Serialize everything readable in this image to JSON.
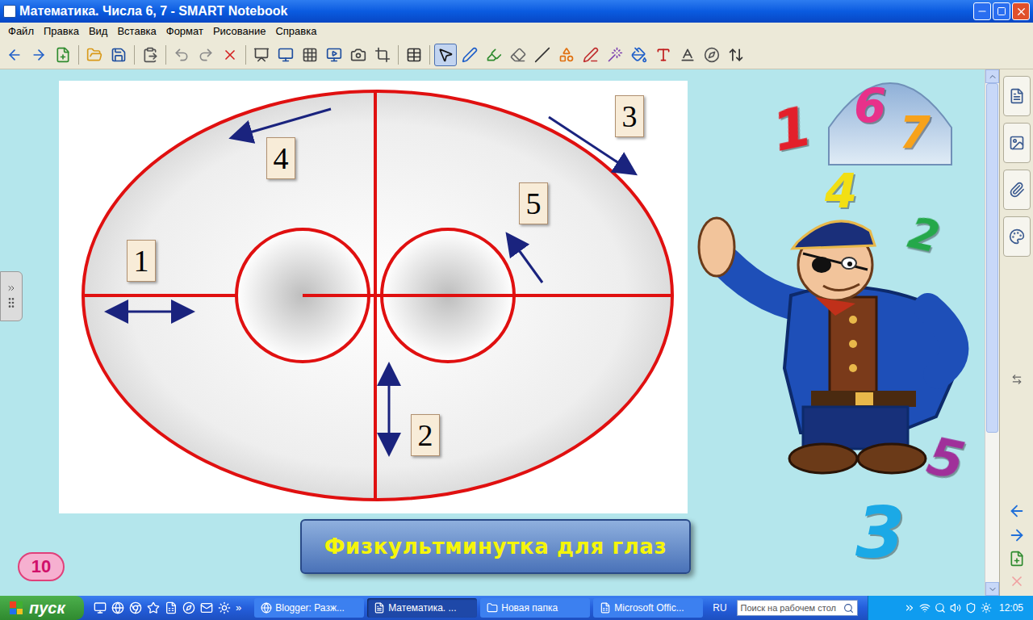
{
  "window": {
    "title": "Математика. Числа 6, 7 - SMART Notebook"
  },
  "menu": [
    "Файл",
    "Правка",
    "Вид",
    "Вставка",
    "Формат",
    "Рисование",
    "Справка"
  ],
  "toolbar": [
    {
      "selected": false
    },
    {
      "selected": false
    },
    {
      "selected": false
    },
    {
      "selected": false
    },
    {
      "selected": false
    },
    {
      "selected": false
    },
    {
      "selected": false
    },
    {
      "selected": false
    },
    {
      "selected": false
    },
    {
      "selected": false
    },
    {
      "selected": false
    },
    {
      "selected": false
    },
    {
      "selected": false
    },
    {
      "selected": false
    },
    {
      "selected": false
    },
    {
      "selected": false
    },
    {
      "selected": true
    },
    {
      "selected": false
    },
    {
      "selected": false
    },
    {
      "selected": false
    },
    {
      "selected": false
    },
    {
      "selected": false
    },
    {
      "selected": false
    },
    {
      "selected": false
    },
    {
      "selected": false
    },
    {
      "selected": false
    },
    {
      "selected": false
    },
    {
      "selected": false
    },
    {
      "selected": false
    }
  ],
  "diagram": {
    "labels": [
      "1",
      "2",
      "3",
      "4",
      "5"
    ]
  },
  "caption": "Физкультминутка для глаз",
  "decor_digits": [
    {
      "text": "1",
      "color": "#e3202b"
    },
    {
      "text": "6",
      "color": "#e8318a"
    },
    {
      "text": "7",
      "color": "#f7a21b"
    },
    {
      "text": "4",
      "color": "#f2df14"
    },
    {
      "text": "2",
      "color": "#25a84a"
    },
    {
      "text": "5",
      "color": "#a0309a"
    },
    {
      "text": "3",
      "color": "#1ba9e6"
    }
  ],
  "page_badge": "10",
  "scrollbar": {
    "level": 0.7
  },
  "taskbar": {
    "start": "пуск",
    "quick_launch_more": "»",
    "tasks": [
      {
        "label": "Blogger: Разж...",
        "selected": false
      },
      {
        "label": "Математика. ...",
        "selected": true
      },
      {
        "label": "Новая папка",
        "selected": false
      },
      {
        "label": "Microsoft Offic...",
        "selected": false
      }
    ],
    "language": "RU",
    "search_placeholder": "Поиск на рабочем стол",
    "clock": "12:05"
  }
}
